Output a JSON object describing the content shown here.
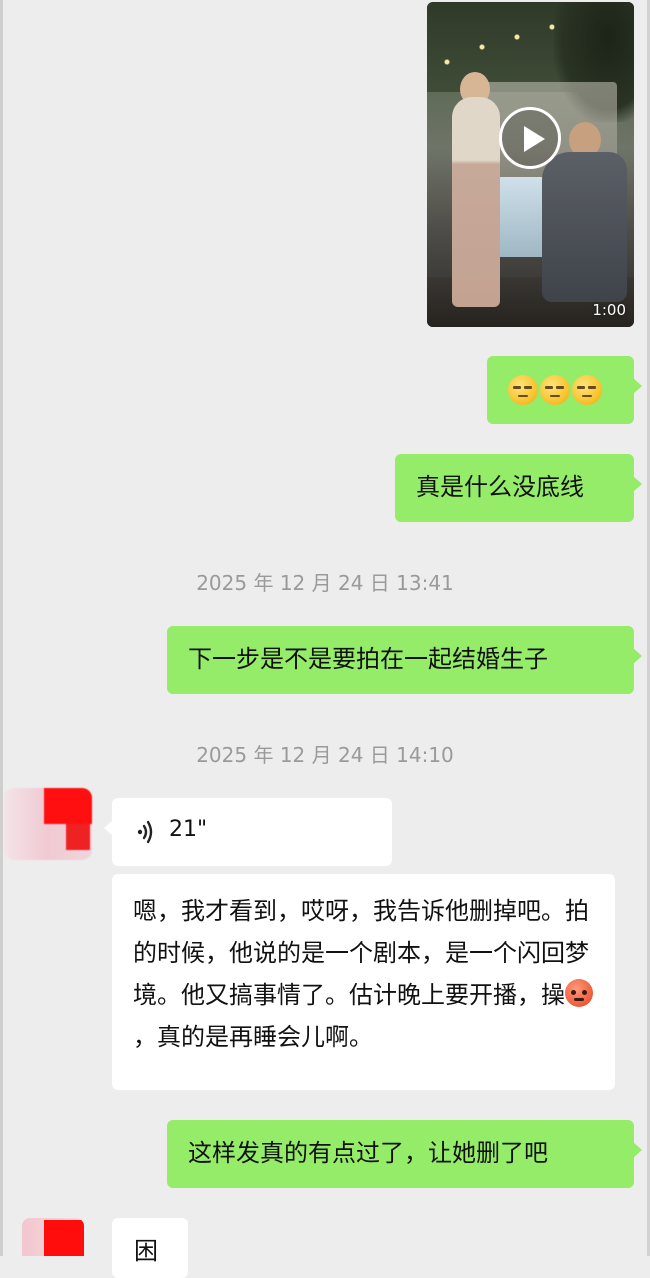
{
  "video": {
    "duration": "1:00"
  },
  "messages": {
    "emoji_bubble": {
      "emoji_count": 3,
      "emoji_name": "unamused-face-emoji"
    },
    "msg1": "真是什么没底线",
    "time1": "2025 年 12 月 24 日 13:41",
    "msg2": "下一步是不是要拍在一起结婚生子",
    "time2": "2025 年 12 月 24 日 14:10",
    "voice": {
      "duration": "21\""
    },
    "reply_part1": "嗯，我才看到，哎呀，我告诉他删掉吧。拍的时候，他说的是一个剧本，是一个闪回梦境。他又搞事情了。估计晚上要开播，操",
    "reply_part2": "，真的是再睡会儿啊。",
    "msg3": "这样发真的有点过了，让她删了吧",
    "partial_reply": "困"
  },
  "colors": {
    "sent_bubble": "#95ec69",
    "received_bubble": "#ffffff",
    "background": "#ededed",
    "timestamp": "#9a9a9a"
  }
}
